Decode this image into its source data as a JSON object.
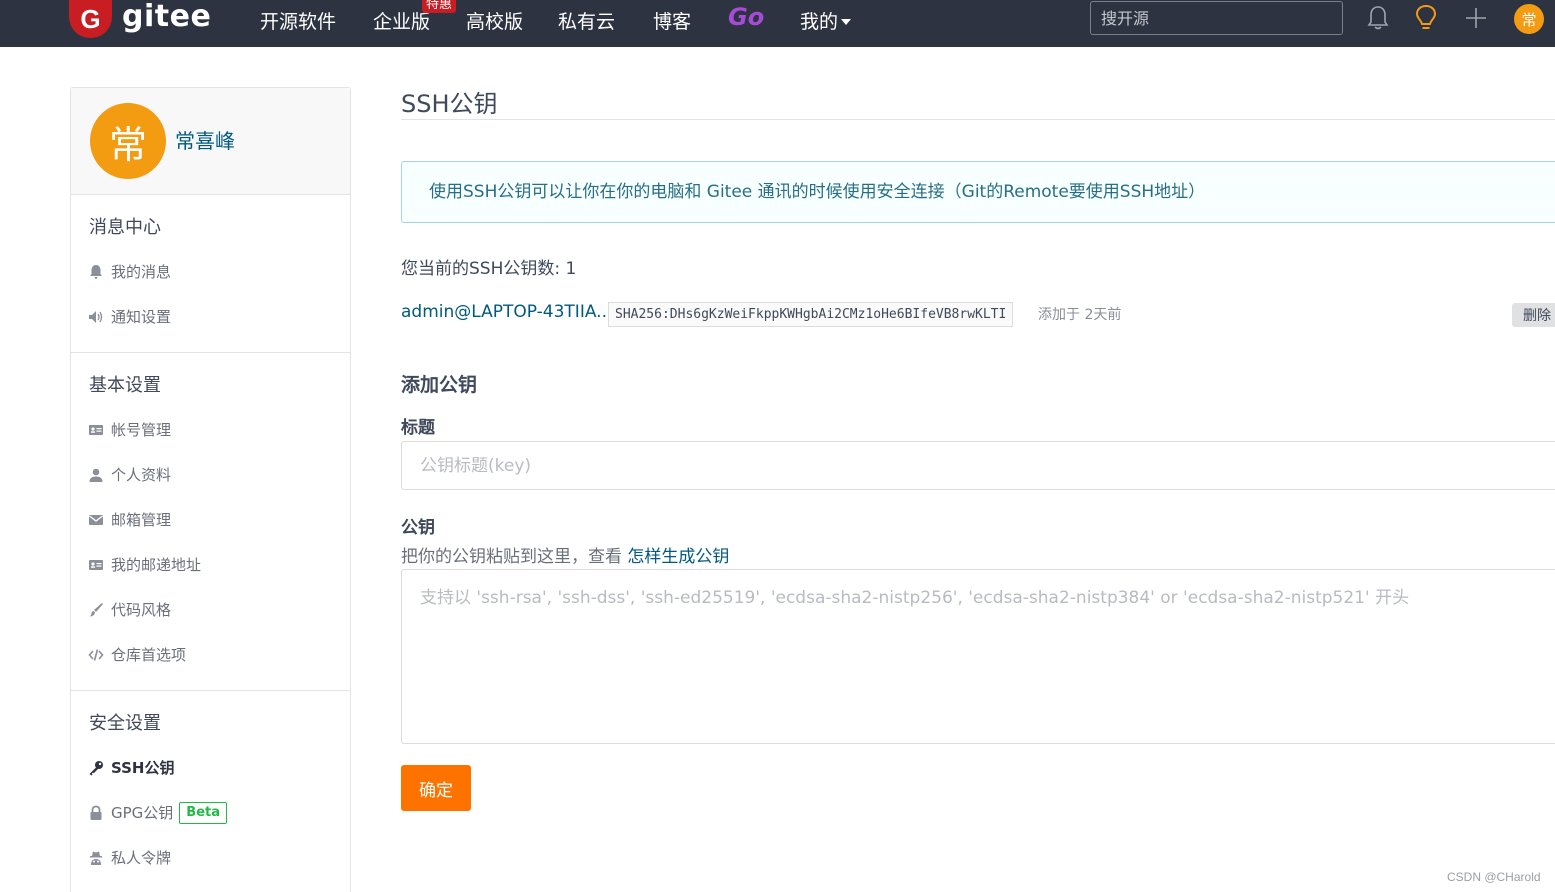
{
  "nav": {
    "logo_letter": "G",
    "logo_text": "gitee",
    "items": [
      "开源软件",
      "企业版",
      "高校版",
      "私有云",
      "博客"
    ],
    "badge": "特惠",
    "go": "Go",
    "mine": "我的",
    "search_placeholder": "搜开源",
    "avatar_char": "常"
  },
  "profile": {
    "avatar_char": "常",
    "name": "常喜峰"
  },
  "sidebar": {
    "sections": [
      {
        "title": "消息中心",
        "items": [
          {
            "label": "我的消息",
            "icon": "bell-icon"
          },
          {
            "label": "通知设置",
            "icon": "volume-icon"
          }
        ]
      },
      {
        "title": "基本设置",
        "items": [
          {
            "label": "帐号管理",
            "icon": "id-card-icon"
          },
          {
            "label": "个人资料",
            "icon": "user-icon"
          },
          {
            "label": "邮箱管理",
            "icon": "envelope-icon"
          },
          {
            "label": "我的邮递地址",
            "icon": "id-card-icon"
          },
          {
            "label": "代码风格",
            "icon": "paint-brush-icon"
          },
          {
            "label": "仓库首选项",
            "icon": "code-icon"
          }
        ]
      },
      {
        "title": "安全设置",
        "items": [
          {
            "label": "SSH公钥",
            "icon": "key-icon",
            "active": true
          },
          {
            "label": "GPG公钥",
            "icon": "lock-icon",
            "badge": "Beta"
          },
          {
            "label": "私人令牌",
            "icon": "spy-icon"
          }
        ]
      }
    ]
  },
  "main": {
    "title": "SSH公钥",
    "info": "使用SSH公钥可以让你在你的电脑和 Gitee 通讯的时候使用安全连接（Git的Remote要使用SSH地址）",
    "count_text": "您当前的SSH公钥数: 1",
    "key": {
      "name": "admin@LAPTOP-43TIIA...",
      "fingerprint": "SHA256:DHs6gKzWeiFkppKWHgbAi2CMz1oHe6BIfeVB8rwKLTI",
      "added": "添加于 2天前",
      "delete_label": "删除"
    },
    "add_heading": "添加公钥",
    "title_label": "标题",
    "title_placeholder": "公钥标题(key)",
    "key_label": "公钥",
    "hint_text": "把你的公钥粘贴到这里，查看 ",
    "hint_link": "怎样生成公钥",
    "key_placeholder": "支持以 'ssh-rsa', 'ssh-dss', 'ssh-ed25519', 'ecdsa-sha2-nistp256', 'ecdsa-sha2-nistp384' or 'ecdsa-sha2-nistp521' 开头",
    "submit_label": "确定"
  },
  "watermark": "CSDN @CHarold",
  "colors": {
    "nav_bg": "#2e3341",
    "brand_red": "#c71d23",
    "avatar_orange": "#f39c12",
    "submit_orange": "#fe7300",
    "link_blue": "#005980",
    "go_purple": "#a64bd8"
  }
}
